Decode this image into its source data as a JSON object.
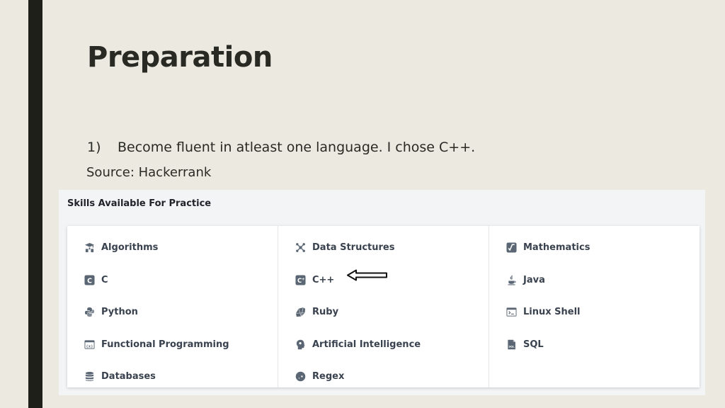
{
  "slide": {
    "title": "Preparation",
    "point_number": "1)",
    "point_text": "Become fluent in atleast one language. I chose C++.",
    "source": "Source: Hackerrank"
  },
  "panel": {
    "heading": "Skills Available For Practice",
    "columns": [
      [
        {
          "label": "Algorithms",
          "icon": "algorithms-icon"
        },
        {
          "label": "C",
          "icon": "c-language-icon"
        },
        {
          "label": "Python",
          "icon": "python-icon"
        },
        {
          "label": "Functional Programming",
          "icon": "functional-programming-icon"
        },
        {
          "label": "Databases",
          "icon": "database-icon"
        }
      ],
      [
        {
          "label": "Data Structures",
          "icon": "data-structures-icon"
        },
        {
          "label": "C++",
          "icon": "cpp-icon"
        },
        {
          "label": "Ruby",
          "icon": "ruby-icon"
        },
        {
          "label": "Artificial Intelligence",
          "icon": "ai-head-icon"
        },
        {
          "label": "Regex",
          "icon": "regex-icon"
        }
      ],
      [
        {
          "label": "Mathematics",
          "icon": "mathematics-icon"
        },
        {
          "label": "Java",
          "icon": "java-icon"
        },
        {
          "label": "Linux Shell",
          "icon": "terminal-icon"
        },
        {
          "label": "SQL",
          "icon": "sql-icon"
        }
      ]
    ]
  },
  "colors": {
    "background": "#ECE9E1",
    "accent_bar": "#1E1F18",
    "panel_bg": "#F2F4F6",
    "card_bg": "#FFFFFF",
    "skill_text": "#39424E",
    "icon": "#5A6673"
  }
}
